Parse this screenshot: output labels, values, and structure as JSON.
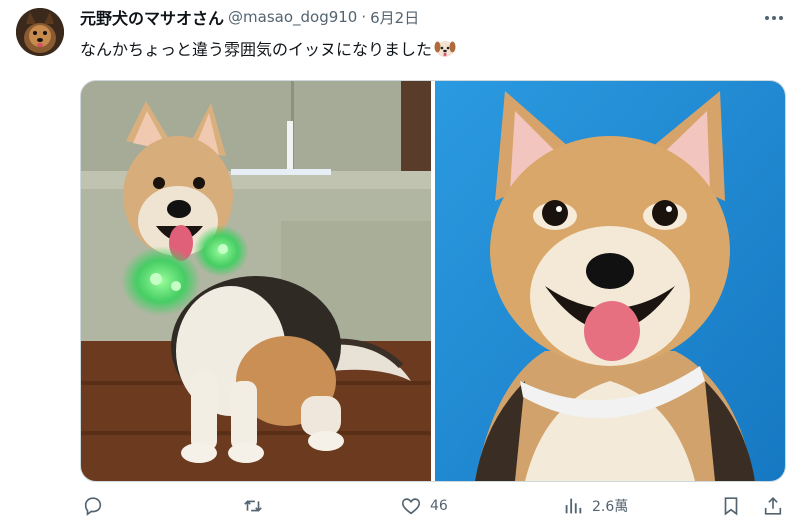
{
  "tweet": {
    "author": {
      "display_name": "元野犬のマサオさん",
      "handle": "@masao_dog910",
      "avatar_icon": "dog-avatar"
    },
    "separator": "·",
    "date": "6月2日",
    "text": "なんかちょっと違う雰囲気のイッヌになりました",
    "text_emoji": "dog-face-emoji",
    "media": [
      {
        "icon": "dog-photo-with-glowing-collar"
      },
      {
        "icon": "dog-portrait-blue-background"
      }
    ],
    "actions": {
      "reply": {
        "icon": "reply-icon"
      },
      "retweet": {
        "icon": "retweet-icon"
      },
      "like": {
        "icon": "heart-icon",
        "count": "46"
      },
      "views": {
        "icon": "views-icon",
        "count": "2.6萬"
      },
      "bookmark": {
        "icon": "bookmark-icon"
      },
      "share": {
        "icon": "share-icon"
      }
    }
  },
  "colors": {
    "text_primary": "#0f1419",
    "text_secondary": "#536471",
    "border": "#cfd9de",
    "photo_bg_blue": "#1f8fd6"
  }
}
